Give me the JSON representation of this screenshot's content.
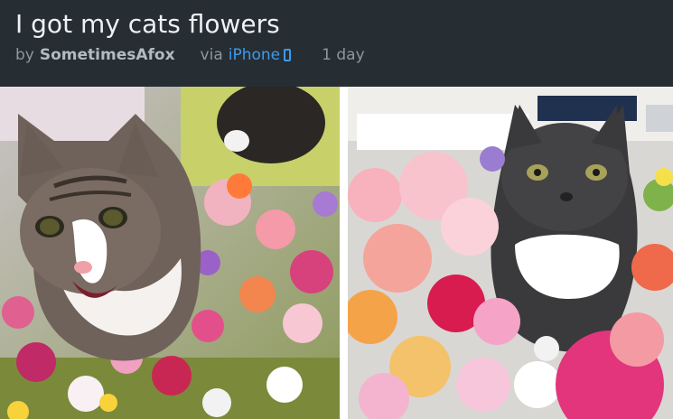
{
  "post": {
    "title": "I got my cats flowers",
    "by_label": "by",
    "author": "SometimesAfox",
    "via_label": "via",
    "device": "iPhone",
    "age": "1 day"
  },
  "icons": {
    "device_icon": "phone-icon"
  },
  "colors": {
    "header_bg": "#262d33",
    "title_text": "#eef1f4",
    "meta_text": "#8e97a1",
    "link_blue": "#3d9be9"
  }
}
